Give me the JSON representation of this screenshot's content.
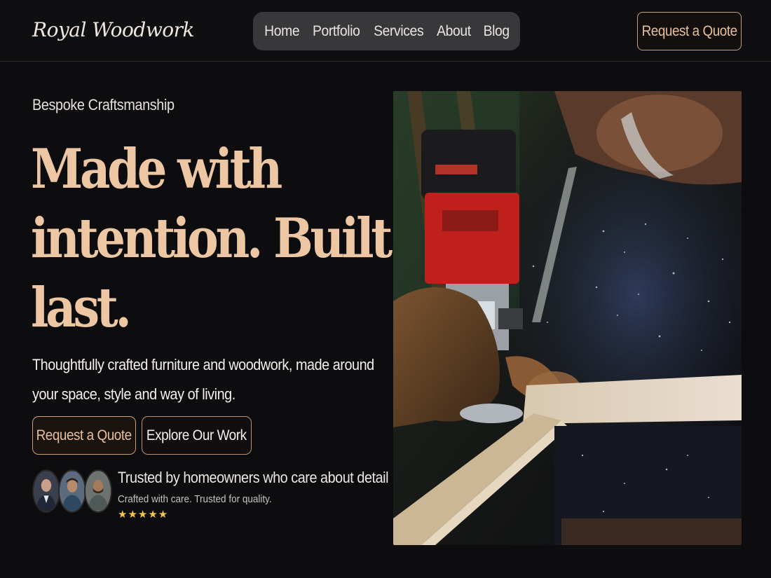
{
  "header": {
    "brand": "Royal Woodwork",
    "nav": [
      "Home",
      "Portfolio",
      "Services",
      "About",
      "Blog"
    ],
    "cta": "Request a Quote"
  },
  "hero": {
    "eyebrow": "Bespoke Craftsmanship",
    "headline_lines": [
      "Made with",
      "intention. Built to",
      "last."
    ],
    "subtext": "Thoughtfully crafted furniture and woodwork, made around your space, style and way of living.",
    "primary_button": "Request a Quote",
    "secondary_button": "Explore Our Work",
    "trust_title": "Trusted by homeowners who care about detail",
    "trust_subtitle": "Crafted with care. Trusted for quality.",
    "rating_stars": "★★★★★",
    "rating": 5,
    "image_icon": "woodworker-router-photo"
  },
  "colors": {
    "background": "#0d0c0e",
    "accent": "#edc7a3",
    "button_border": "#c8a07c",
    "nav_bg": "#38373a",
    "star": "#f2c84b"
  }
}
